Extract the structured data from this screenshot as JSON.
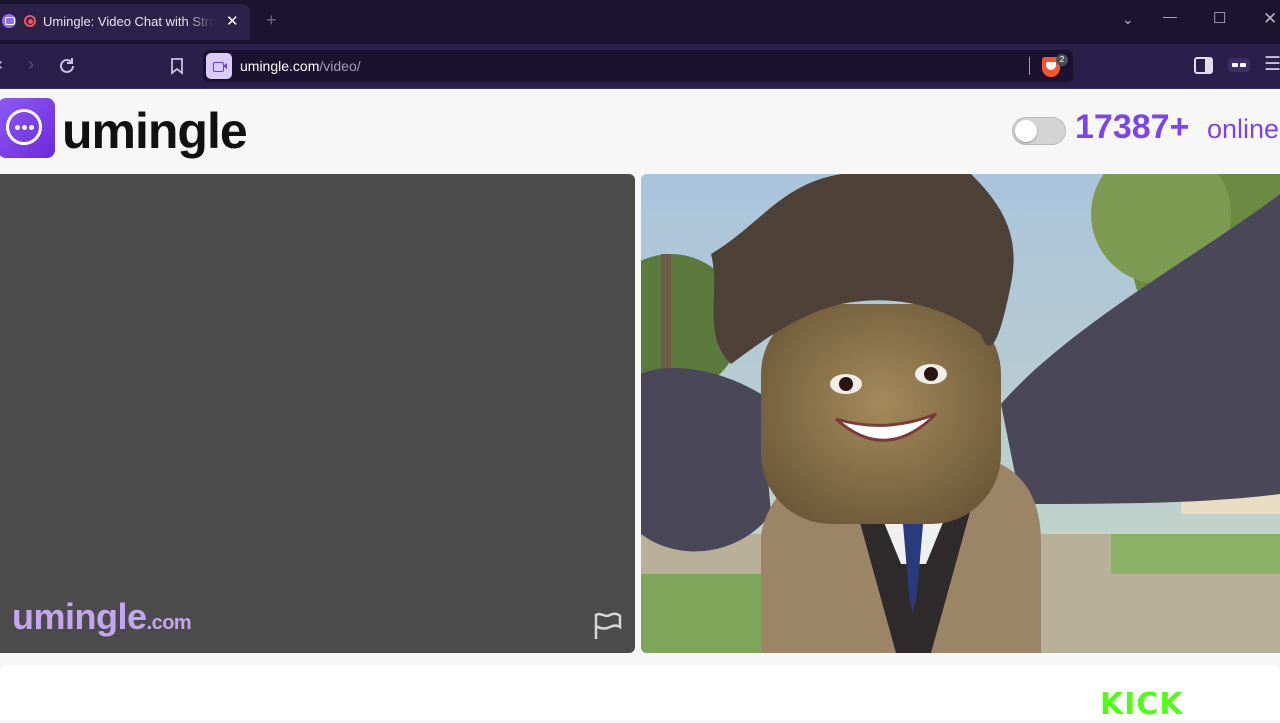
{
  "browser": {
    "tab_title": "Umingle: Video Chat with Strangers",
    "url_host": "umingle.com",
    "url_path": "/video/",
    "shield_count": "2"
  },
  "site": {
    "logo_text": "umingle",
    "online_count": "17387+",
    "online_label": "online"
  },
  "video_left": {
    "watermark_main": "umingle",
    "watermark_suffix": ".com"
  },
  "footer": {
    "sponsor_logo": "KICK"
  },
  "colors": {
    "brand": "#7b45e8",
    "chrome_bg": "#1b1430",
    "kick_green": "#53fc18"
  }
}
